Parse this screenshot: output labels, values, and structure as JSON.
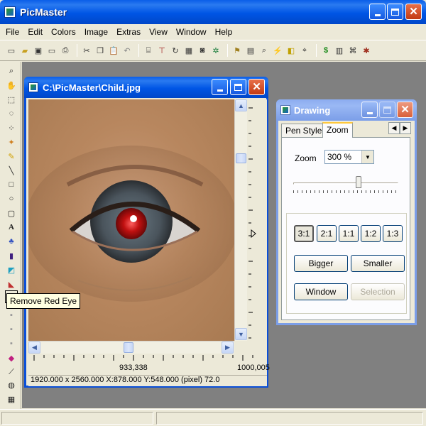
{
  "app": {
    "title": "PicMaster"
  },
  "menu": [
    "File",
    "Edit",
    "Colors",
    "Image",
    "Extras",
    "View",
    "Window",
    "Help"
  ],
  "toolbar_icons": [
    "new-icon",
    "open-icon",
    "save-icon",
    "export-icon",
    "print-icon",
    "cut-icon",
    "copy-icon",
    "paste-icon",
    "undo-icon",
    "scan-icon",
    "crop-icon",
    "rotate-icon",
    "gallery-icon",
    "camera-icon",
    "settings-icon",
    "find-icon",
    "flash-icon",
    "tag-icon",
    "dollar-icon",
    "tree-icon",
    "barcode-icon",
    "bug-icon"
  ],
  "tools": [
    "zoom-tool-icon",
    "hand-tool-icon",
    "rect-select-icon",
    "lasso-icon",
    "magic-select-icon",
    "wand-icon",
    "pencil-icon",
    "line-icon",
    "rectangle-icon",
    "ellipse-icon",
    "rounded-rect-icon",
    "text-icon",
    "fill-icon",
    "brush-icon",
    "gradient-icon",
    "eraser-icon",
    "red-eye-icon",
    "clone-icon",
    "smudge-icon",
    "sharpen-icon",
    "color-replace-icon",
    "dropper-icon",
    "spray-icon",
    "stamp-icon"
  ],
  "tooltip": "Remove Red Eye",
  "image_window": {
    "title": "C:\\PicMaster\\Child.jpg",
    "ruler_mid": "933,338",
    "ruler_end": "1000,005",
    "status": "1920.000 x 2560.000    X:878.000  Y:548.000 (pixel)  72.0"
  },
  "drawing_window": {
    "title": "Drawing",
    "tabs": [
      "Pen Style",
      "Zoom"
    ],
    "active_tab": "Zoom",
    "zoom_label": "Zoom",
    "zoom_value": "300 %",
    "zoom_slider_fraction": 0.62,
    "ratio_buttons": [
      "3:1",
      "2:1",
      "1:1",
      "1:2",
      "1:3"
    ],
    "selected_ratio": "3:1",
    "bigger": "Bigger",
    "smaller": "Smaller",
    "window": "Window",
    "selection": "Selection"
  }
}
